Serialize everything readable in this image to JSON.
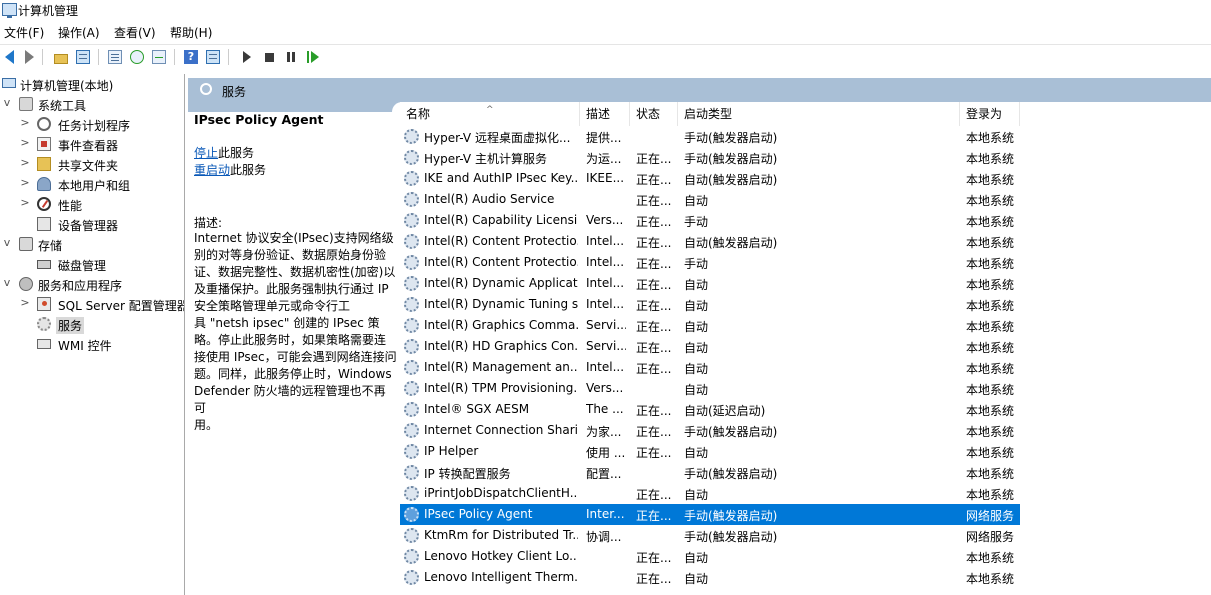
{
  "window": {
    "title": "计算机管理"
  },
  "menu": [
    "文件(F)",
    "操作(A)",
    "查看(V)",
    "帮助(H)"
  ],
  "toolbar": {
    "icons": [
      "back-icon",
      "forward-icon",
      "up-folder-icon",
      "show-hide-tree-icon",
      "properties-icon",
      "refresh-icon",
      "export-icon",
      "help-icon",
      "action-pane-icon",
      "start-service-icon",
      "stop-service-icon",
      "pause-service-icon",
      "resume-service-icon"
    ]
  },
  "tree": {
    "items": [
      {
        "label": "计算机管理(本地)",
        "icon": "computer-icon",
        "level": 0,
        "exp": ""
      },
      {
        "label": "系统工具",
        "icon": "tools-icon",
        "level": 1,
        "exp": "v"
      },
      {
        "label": "任务计划程序",
        "icon": "clock-icon",
        "level": 2,
        "exp": ">"
      },
      {
        "label": "事件查看器",
        "icon": "event-viewer-icon",
        "level": 2,
        "exp": ">"
      },
      {
        "label": "共享文件夹",
        "icon": "shared-folder-icon",
        "level": 2,
        "exp": ">"
      },
      {
        "label": "本地用户和组",
        "icon": "users-icon",
        "level": 2,
        "exp": ">"
      },
      {
        "label": "性能",
        "icon": "performance-icon",
        "level": 2,
        "exp": ">"
      },
      {
        "label": "设备管理器",
        "icon": "device-manager-icon",
        "level": 2,
        "exp": ""
      },
      {
        "label": "存储",
        "icon": "storage-icon",
        "level": 1,
        "exp": "v"
      },
      {
        "label": "磁盘管理",
        "icon": "disk-icon",
        "level": 2,
        "exp": ""
      },
      {
        "label": "服务和应用程序",
        "icon": "services-apps-icon",
        "level": 1,
        "exp": "v"
      },
      {
        "label": "SQL Server 配置管理器",
        "icon": "sql-server-icon",
        "level": 2,
        "exp": ">"
      },
      {
        "label": "服务",
        "icon": "gear-icon",
        "level": 2,
        "exp": "",
        "selected": true
      },
      {
        "label": "WMI 控件",
        "icon": "wmi-icon",
        "level": 2,
        "exp": ""
      }
    ]
  },
  "header": {
    "title": "服务"
  },
  "detail": {
    "service_name": "IPsec Policy Agent",
    "stop_link": "停止",
    "stop_suffix": "此服务",
    "restart_link": "重启动",
    "restart_suffix": "此服务",
    "desc_label": "描述:",
    "desc_lines": [
      "Internet 协议安全(IPsec)支持网络级",
      "别的对等身份验证、数据原始身份验",
      "证、数据完整性、数据机密性(加密)以",
      "及重播保护。此服务强制执行通过 IP",
      "安全策略管理单元或命令行工",
      "具 \"netsh ipsec\" 创建的 IPsec 策",
      "略。停止此服务时，如果策略需要连",
      "接使用 IPsec，可能会遇到网络连接问",
      "题。同样，此服务停止时，Windows",
      "Defender 防火墙的远程管理也不再可",
      "用。"
    ]
  },
  "columns": [
    "名称",
    "描述",
    "状态",
    "启动类型",
    "登录为"
  ],
  "services": [
    {
      "name": "Hyper-V 远程桌面虚拟化...",
      "desc": "提供...",
      "status": "",
      "startup": "手动(触发器启动)",
      "logon": "本地系统"
    },
    {
      "name": "Hyper-V 主机计算服务",
      "desc": "为运...",
      "status": "正在...",
      "startup": "手动(触发器启动)",
      "logon": "本地系统"
    },
    {
      "name": "IKE and AuthIP IPsec Key...",
      "desc": "IKEE...",
      "status": "正在...",
      "startup": "自动(触发器启动)",
      "logon": "本地系统"
    },
    {
      "name": "Intel(R) Audio Service",
      "desc": "",
      "status": "正在...",
      "startup": "自动",
      "logon": "本地系统"
    },
    {
      "name": "Intel(R) Capability Licensi...",
      "desc": "Vers...",
      "status": "正在...",
      "startup": "手动",
      "logon": "本地系统"
    },
    {
      "name": "Intel(R) Content Protectio...",
      "desc": "Intel...",
      "status": "正在...",
      "startup": "自动(触发器启动)",
      "logon": "本地系统"
    },
    {
      "name": "Intel(R) Content Protectio...",
      "desc": "Intel...",
      "status": "正在...",
      "startup": "手动",
      "logon": "本地系统"
    },
    {
      "name": "Intel(R) Dynamic Applicat...",
      "desc": "Intel...",
      "status": "正在...",
      "startup": "自动",
      "logon": "本地系统"
    },
    {
      "name": "Intel(R) Dynamic Tuning s...",
      "desc": "Intel...",
      "status": "正在...",
      "startup": "自动",
      "logon": "本地系统"
    },
    {
      "name": "Intel(R) Graphics Comma...",
      "desc": "Servi...",
      "status": "正在...",
      "startup": "自动",
      "logon": "本地系统"
    },
    {
      "name": "Intel(R) HD Graphics Con...",
      "desc": "Servi...",
      "status": "正在...",
      "startup": "自动",
      "logon": "本地系统"
    },
    {
      "name": "Intel(R) Management an...",
      "desc": "Intel...",
      "status": "正在...",
      "startup": "自动",
      "logon": "本地系统"
    },
    {
      "name": "Intel(R) TPM Provisioning...",
      "desc": "Vers...",
      "status": "",
      "startup": "自动",
      "logon": "本地系统"
    },
    {
      "name": "Intel® SGX AESM",
      "desc": "The ...",
      "status": "正在...",
      "startup": "自动(延迟启动)",
      "logon": "本地系统"
    },
    {
      "name": "Internet Connection Shari...",
      "desc": "为家...",
      "status": "正在...",
      "startup": "手动(触发器启动)",
      "logon": "本地系统"
    },
    {
      "name": "IP Helper",
      "desc": "使用 ...",
      "status": "正在...",
      "startup": "自动",
      "logon": "本地系统"
    },
    {
      "name": "IP 转换配置服务",
      "desc": "配置...",
      "status": "",
      "startup": "手动(触发器启动)",
      "logon": "本地系统"
    },
    {
      "name": "iPrintJobDispatchClientH...",
      "desc": "",
      "status": "正在...",
      "startup": "自动",
      "logon": "本地系统"
    },
    {
      "name": "IPsec Policy Agent",
      "desc": "Inter...",
      "status": "正在...",
      "startup": "手动(触发器启动)",
      "logon": "网络服务",
      "selected": true
    },
    {
      "name": "KtmRm for Distributed Tr...",
      "desc": "协调...",
      "status": "",
      "startup": "手动(触发器启动)",
      "logon": "网络服务"
    },
    {
      "name": "Lenovo Hotkey Client Lo...",
      "desc": "",
      "status": "正在...",
      "startup": "自动",
      "logon": "本地系统"
    },
    {
      "name": "Lenovo Intelligent Therm...",
      "desc": "",
      "status": "正在...",
      "startup": "自动",
      "logon": "本地系统"
    }
  ]
}
